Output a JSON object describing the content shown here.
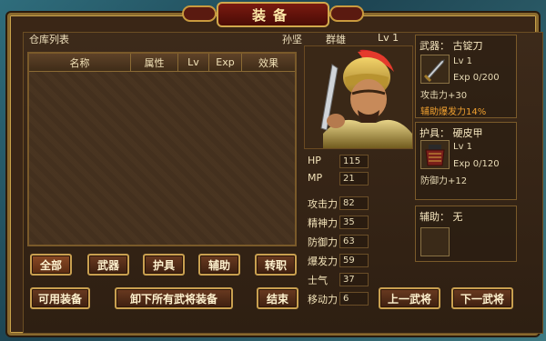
{
  "window": {
    "title": "装备"
  },
  "header": {
    "list_title": "仓库列表",
    "general_name": "孙坚",
    "faction": "群雄",
    "level": "Lv 1"
  },
  "list": {
    "columns": [
      "名称",
      "属性",
      "Lv",
      "Exp",
      "效果"
    ],
    "rows": []
  },
  "filter_tabs": [
    {
      "label": "全部",
      "active": true
    },
    {
      "label": "武器",
      "active": false
    },
    {
      "label": "护具",
      "active": false
    },
    {
      "label": "辅助",
      "active": false
    },
    {
      "label": "转职",
      "active": false
    }
  ],
  "actions": {
    "usable_equip": "可用装备",
    "unequip_all": "卸下所有武将装备",
    "end": "结束",
    "prev_general": "上一武将",
    "next_general": "下一武将"
  },
  "stats": [
    {
      "label": "HP",
      "value": "115"
    },
    {
      "label": "MP",
      "value": "21"
    },
    {
      "label": "攻击力",
      "value": "82"
    },
    {
      "label": "精神力",
      "value": "35"
    },
    {
      "label": "防御力",
      "value": "63"
    },
    {
      "label": "爆发力",
      "value": "59"
    },
    {
      "label": "士气",
      "value": "37"
    },
    {
      "label": "移动力",
      "value": "6"
    }
  ],
  "weapon": {
    "header": "武器： 古锭刀",
    "level": "Lv  1",
    "exp": "Exp 0/200",
    "effect": "攻击力+30",
    "bonus": "辅助爆发力14%",
    "icon": "sword-icon"
  },
  "armor": {
    "header": "护具： 硬皮甲",
    "level": "Lv  1",
    "exp": "Exp 0/120",
    "effect": "防御力+12",
    "icon": "armor-icon"
  },
  "accessory": {
    "header": "辅助： 无"
  }
}
